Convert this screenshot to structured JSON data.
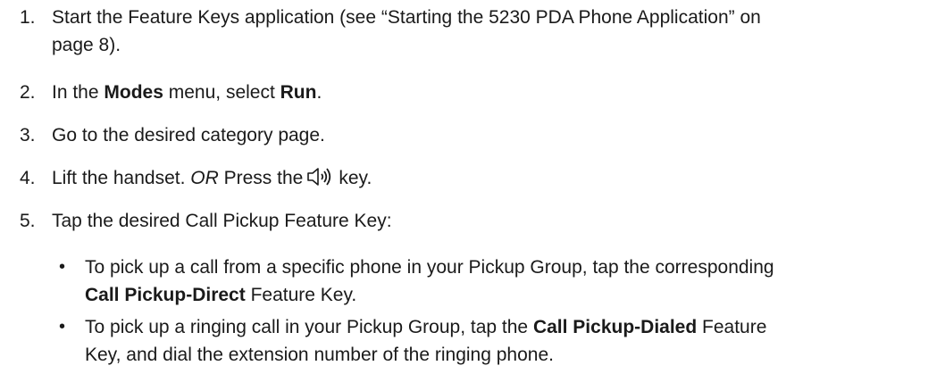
{
  "steps": [
    {
      "number": "1.",
      "line1": "Start the Feature Keys application (see “Starting the 5230 PDA Phone Application” on",
      "line2": "page 8)."
    },
    {
      "number": "2.",
      "pre": "In the ",
      "menu": "Modes",
      "mid": " menu, select ",
      "item": "Run",
      "post": "."
    },
    {
      "number": "3.",
      "text": "Go to the desired category page."
    },
    {
      "number": "4.",
      "pre": "Lift the handset. ",
      "or": "OR",
      "mid": " Press the",
      "post": "key.",
      "icon": "speaker-icon"
    },
    {
      "number": "5.",
      "text": "Tap the desired Call Pickup Feature Key:"
    }
  ],
  "bullets": [
    {
      "symbol": "•",
      "line1": "To pick up a call from a specific phone in your Pickup Group, tap the corresponding",
      "bold": "Call Pickup-Direct",
      "rest": " Feature Key."
    },
    {
      "symbol": "•",
      "pre": "To pick up a ringing call in your Pickup Group, tap the ",
      "bold": "Call Pickup-Dialed",
      "post": " Feature",
      "line2": "Key, and dial the extension number of the ringing phone."
    }
  ]
}
